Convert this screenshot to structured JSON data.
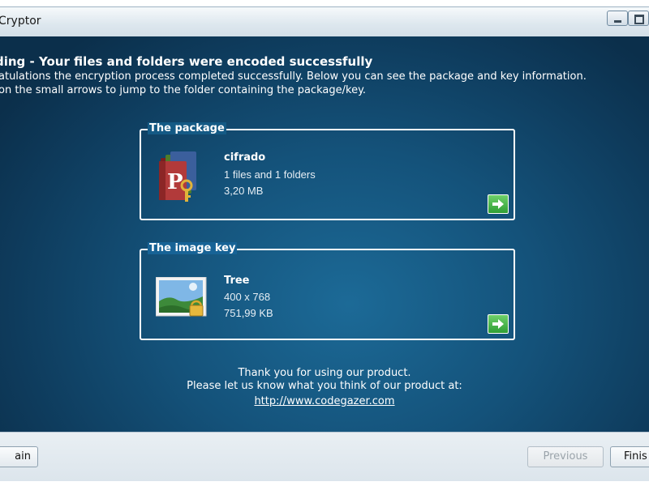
{
  "window": {
    "title": "Cryptor"
  },
  "header": {
    "title_prefix": "ding - ",
    "title_main": "Your files and folders were encoded successfully",
    "description_line1": "atulations the encryption process completed successfully. Below you can see the package and key information.",
    "description_line2": "on the small arrows to jump to the folder containing the package/key."
  },
  "package": {
    "legend": "The package",
    "name": "cifrado",
    "line1": "1 files and 1 folders",
    "line2": "3,20 MB",
    "icon": "package-icon"
  },
  "image_key": {
    "legend": "The image key",
    "name": "Tree",
    "line1": "400 x 768",
    "line2": "751,99 KB",
    "icon": "image-icon"
  },
  "footer": {
    "thanks": "Thank you for using our product.",
    "feedback": "Please let us know what you think of our product at:",
    "link": "http://www.codegazer.com"
  },
  "buttons": {
    "main": "ain",
    "previous": "Previous",
    "finish": "Finis"
  },
  "colors": {
    "accent_green": "#3aa83e",
    "panel_blue": "#14527a"
  }
}
